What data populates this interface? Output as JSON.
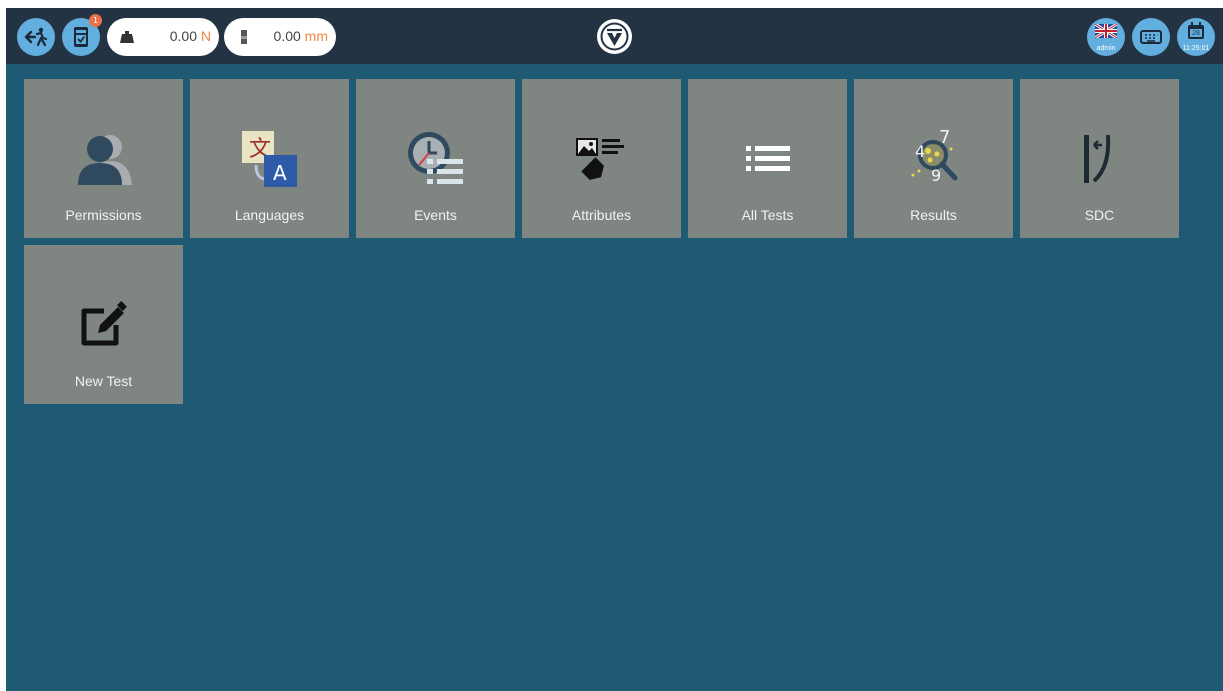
{
  "topbar": {
    "exit_icon": "exit-run-icon",
    "device_badge": "1",
    "force": {
      "value": "0.00",
      "unit": "N"
    },
    "position": {
      "value": "0.00",
      "unit": "mm"
    },
    "user_label": "admin",
    "calendar_day": "28",
    "clock": "11:25:01"
  },
  "tiles": [
    {
      "label": "Permissions",
      "icon": "users-icon"
    },
    {
      "label": "Languages",
      "icon": "translate-icon"
    },
    {
      "label": "Events",
      "icon": "clock-list-icon"
    },
    {
      "label": "Attributes",
      "icon": "image-tag-icon"
    },
    {
      "label": "All Tests",
      "icon": "list-icon"
    },
    {
      "label": "Results",
      "icon": "search-numbers-icon"
    },
    {
      "label": "SDC",
      "icon": "sdc-curve-icon"
    },
    {
      "label": "New Test",
      "icon": "edit-icon"
    }
  ],
  "colors": {
    "topbar": "#233343",
    "background": "#1e5a73",
    "button": "#62aedf",
    "tile": "#7f8580",
    "unit_accent": "#f0883e"
  }
}
